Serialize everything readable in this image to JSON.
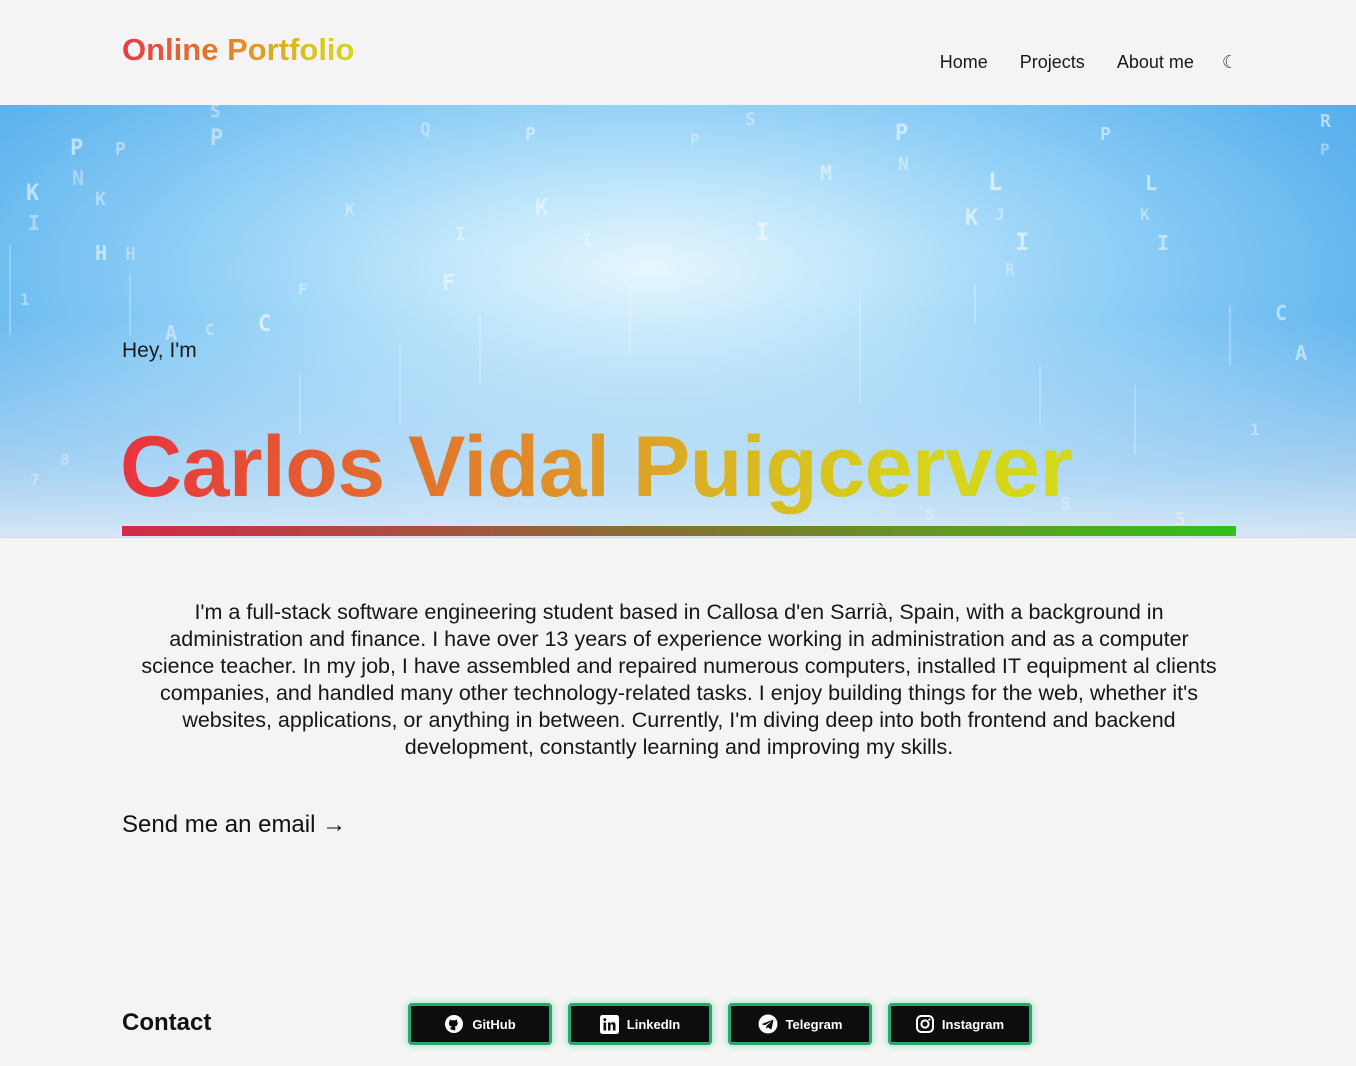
{
  "header": {
    "brand": "Online Portfolio",
    "nav": [
      {
        "label": "Home"
      },
      {
        "label": "Projects"
      },
      {
        "label": "About me"
      }
    ],
    "theme_toggle_icon": "☾"
  },
  "hero": {
    "greeting": "Hey, I'm",
    "name": "Carlos Vidal Puigcerver"
  },
  "bio": {
    "text": "I'm a full-stack software engineering student based in Callosa d'en Sarrià, Spain, with a background in administration and finance. I have over 13 years of experience working in administration and as a computer science teacher. In my job, I have assembled and repaired numerous computers, installed IT equipment al clients companies, and handled many other technology-related tasks. I enjoy building things for the web, whether it's websites, applications, or anything in between. Currently, I'm diving deep into both frontend and backend development, constantly learning and improving my skills."
  },
  "email_link": {
    "label": "Send me an email →"
  },
  "contact": {
    "title": "Contact",
    "buttons": [
      {
        "label": "GitHub",
        "icon": "github-icon"
      },
      {
        "label": "LinkedIn",
        "icon": "linkedin-icon"
      },
      {
        "label": "Telegram",
        "icon": "telegram-icon"
      },
      {
        "label": "Instagram",
        "icon": "instagram-icon"
      }
    ]
  },
  "colors": {
    "background": "#f4f4f4",
    "button_bg": "#0d0d0d",
    "button_border": "#25a872",
    "gradient_start": "#e8323f",
    "gradient_end": "#d4d81a"
  }
}
